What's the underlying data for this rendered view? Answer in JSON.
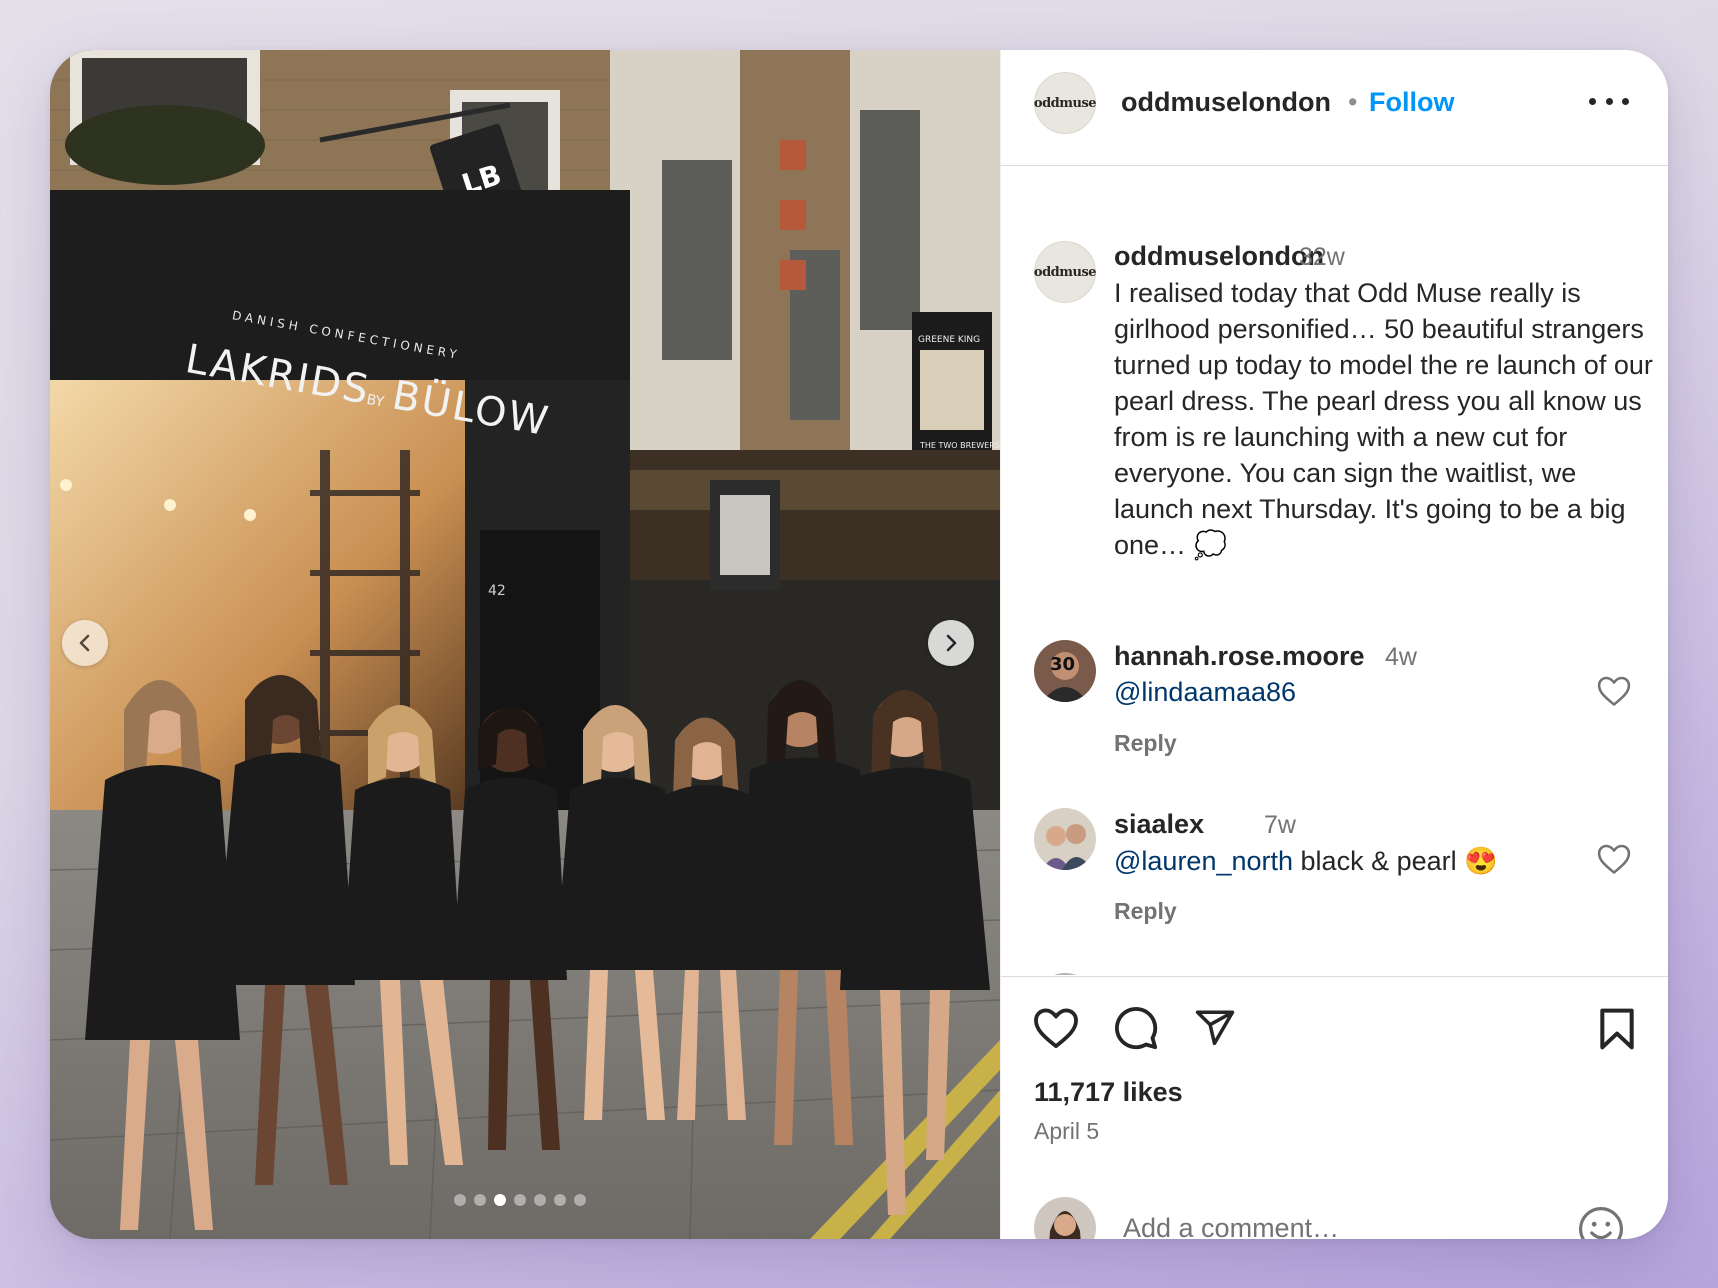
{
  "post": {
    "account": {
      "username": "oddmuselondon",
      "separator": "•",
      "follow_label": "Follow",
      "avatar_text": "oddmuse"
    },
    "photo": {
      "store_sign": "LAKRIDS",
      "store_sign_by": "BY",
      "store_sign_brand": "BÜLOW",
      "store_tagline": "DANISH CONFECTIONERY",
      "pub_sign_top": "GREENE KING",
      "pub_sign_bottom": "THE TWO BREWERS",
      "door_number": "42",
      "carousel_total": 7,
      "carousel_active_index": 2
    },
    "caption": {
      "username": "oddmuselondon",
      "time": "32w",
      "text": "I realised today that Odd Muse really is girlhood personified… 50 beautiful strangers turned up today to model the re launch of our pearl dress. The pearl dress you all know us from is re launching with a new cut for everyone. You can sign the waitlist, we launch next Thursday. It's going to be a big one… 💭"
    },
    "comments": [
      {
        "username": "hannah.rose.moore",
        "time": "4w",
        "mention": "@lindaamaa86",
        "text": "",
        "reply_label": "Reply"
      },
      {
        "username": "siaalex",
        "time": "7w",
        "mention": "@lauren_north",
        "text": " black & pearl 😍",
        "reply_label": "Reply"
      }
    ],
    "likes": "11,717 likes",
    "date": "April 5",
    "add_comment_placeholder": "Add a comment…"
  },
  "icons": {
    "like": "heart-icon",
    "comment": "comment-bubble-icon",
    "share": "paper-plane-icon",
    "save": "bookmark-icon",
    "emoji": "smiley-icon",
    "more": "more-options-icon",
    "prev": "chevron-left-icon",
    "next": "chevron-right-icon"
  },
  "colors": {
    "link_blue": "#0095f6",
    "mention_blue": "#00376b",
    "text_primary": "#262626",
    "text_secondary": "#737373"
  }
}
